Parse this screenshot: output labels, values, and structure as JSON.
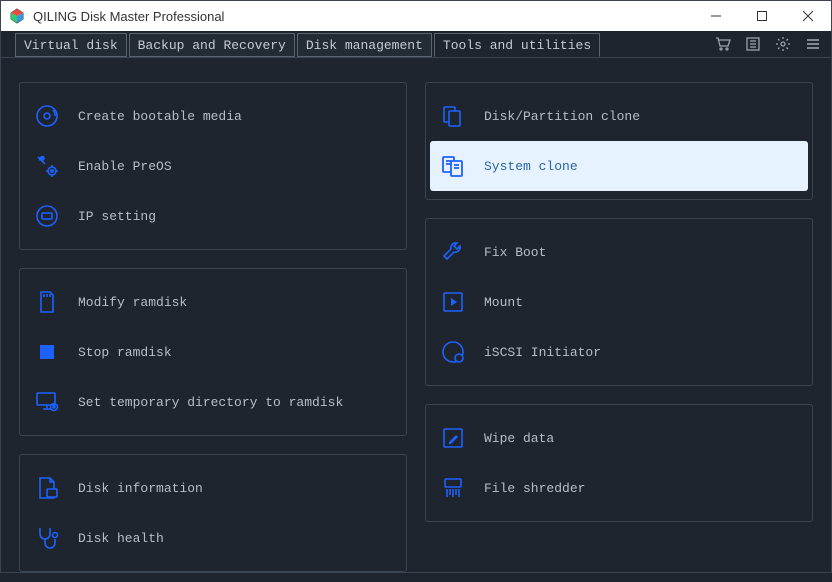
{
  "window": {
    "title": "QILING Disk Master Professional"
  },
  "tabs": {
    "virtual_disk": "Virtual disk",
    "backup_recovery": "Backup and Recovery",
    "disk_management": "Disk management",
    "tools_utilities": "Tools and utilities"
  },
  "left": {
    "panel1": {
      "create_bootable": "Create bootable media",
      "enable_preos": "Enable PreOS",
      "ip_setting": "IP setting"
    },
    "panel2": {
      "modify_ramdisk": "Modify ramdisk",
      "stop_ramdisk": "Stop ramdisk",
      "set_temp_dir": "Set temporary directory to ramdisk"
    },
    "panel3": {
      "disk_info": "Disk information",
      "disk_health": "Disk health"
    }
  },
  "right": {
    "panel1": {
      "partition_clone": "Disk/Partition clone",
      "system_clone": "System clone"
    },
    "panel2": {
      "fix_boot": "Fix Boot",
      "mount": "Mount",
      "iscsi": "iSCSI Initiator"
    },
    "panel3": {
      "wipe_data": "Wipe data",
      "file_shredder": "File shredder"
    }
  },
  "colors": {
    "icon_blue": "#1d62ff",
    "selected_bg": "#e6f2ff",
    "selected_text": "#2a66a2"
  }
}
